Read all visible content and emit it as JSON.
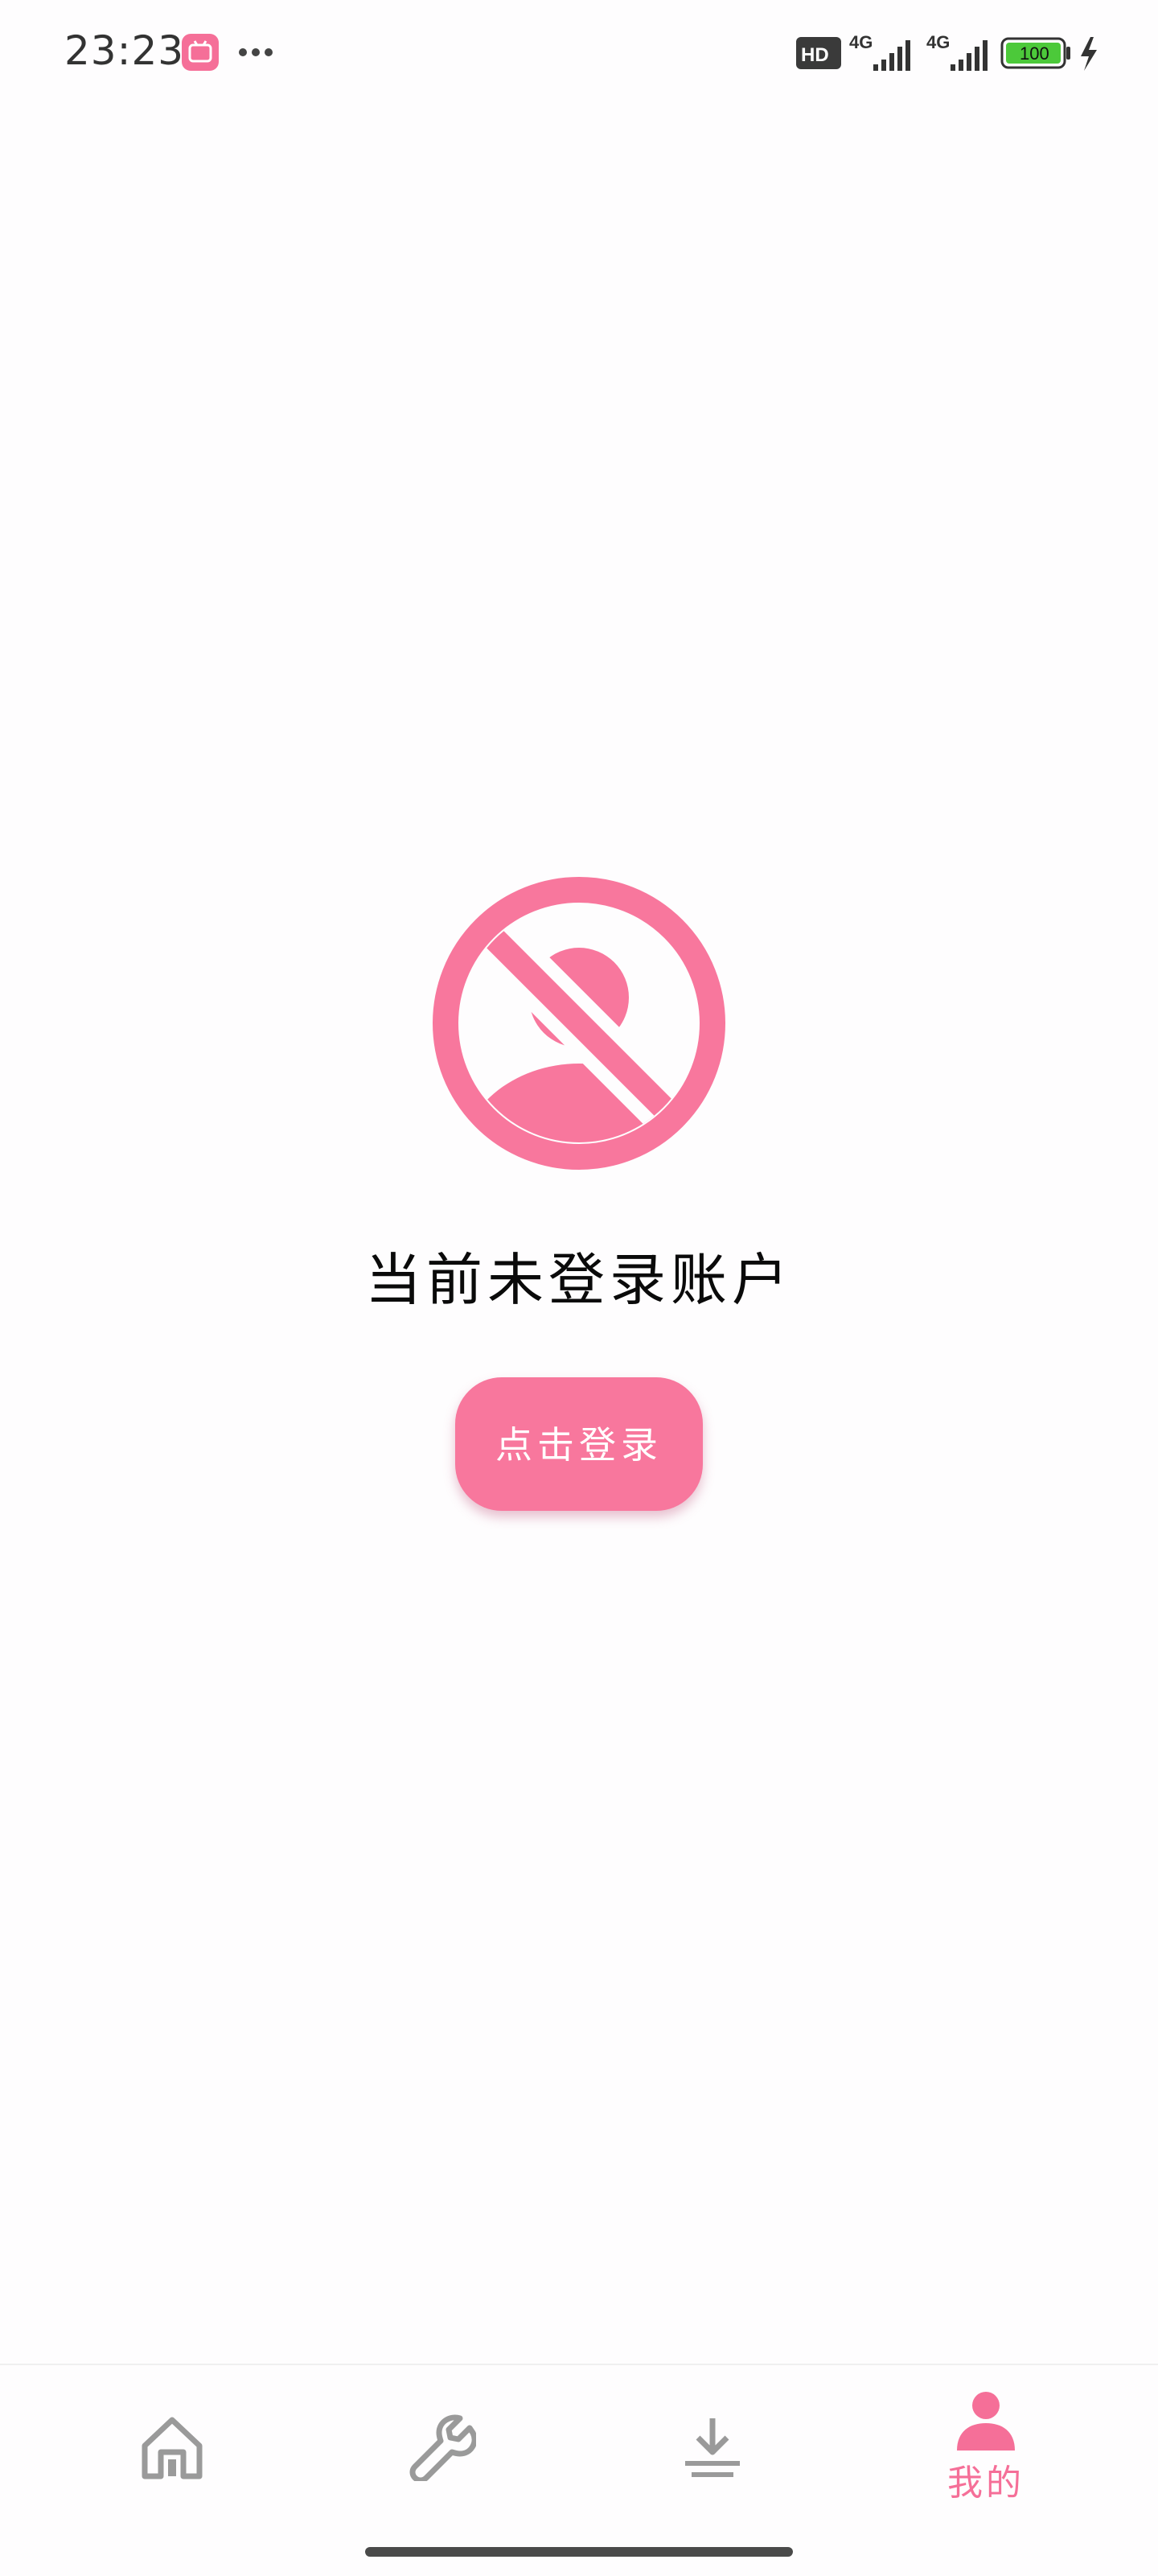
{
  "status_bar": {
    "time": "23:23",
    "battery": "100",
    "network_1": "4G",
    "network_2": "4G",
    "hd_label": "HD"
  },
  "empty_state": {
    "title": "当前未登录账户",
    "login_button": "点击登录"
  },
  "bottom_nav": {
    "items": [
      {
        "icon": "home-icon",
        "label": ""
      },
      {
        "icon": "wrench-icon",
        "label": ""
      },
      {
        "icon": "download-icon",
        "label": ""
      },
      {
        "icon": "person-icon",
        "label": "我的"
      }
    ]
  },
  "colors": {
    "accent": "#f56f98",
    "button": "#f8779d",
    "inactive_icon": "#9a9a9a"
  }
}
